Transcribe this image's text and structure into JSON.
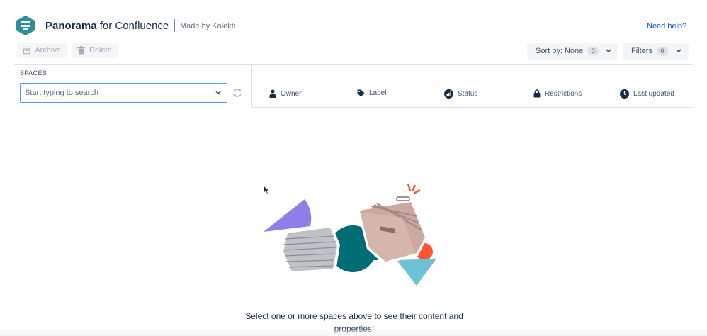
{
  "header": {
    "app_name_bold": "Panorama",
    "app_name_rest": " for Confluence",
    "made_by": "Made by Kolekti",
    "help_link": "Need help?"
  },
  "toolbar": {
    "archive_label": "Archive",
    "delete_label": "Delete",
    "sort_label": "Sort by: None",
    "sort_count": "0",
    "filters_label": "Filters",
    "filters_count": "0"
  },
  "filter_bar": {
    "spaces_label": "SPACES",
    "search_placeholder": "Start typing to search",
    "columns": {
      "owner": "Owner",
      "label": "Label",
      "status": "Status",
      "restrictions": "Restrictions",
      "last_updated": "Last updated"
    }
  },
  "empty_state": {
    "message_line1": "Select one or more spaces above to see their content and",
    "message_line2": "properties!"
  },
  "colors": {
    "link": "#0052cc",
    "focus_border": "#4c9aff",
    "logo_teal": "#2d8e9a",
    "purple": "#8f7ee7",
    "dark_teal": "#006d75",
    "light_teal": "#6cc3d5",
    "orange": "#ff5630"
  }
}
